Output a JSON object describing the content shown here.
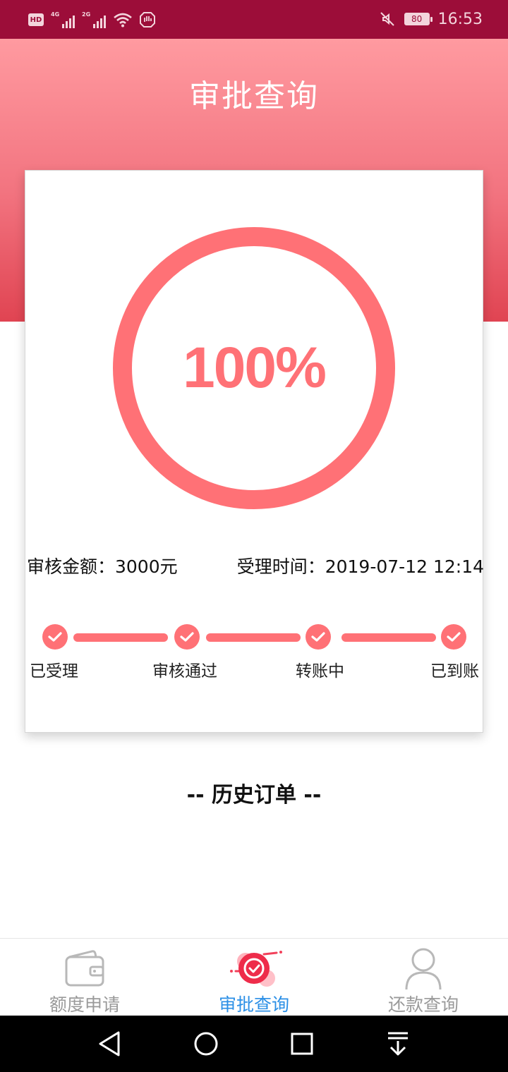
{
  "status_bar": {
    "hd": "HD",
    "signal1_label": "4G",
    "signal2_label": "2G",
    "battery": "80",
    "time": "16:53",
    "icons": [
      "hd-badge",
      "signal-4g-icon",
      "signal-2g-icon",
      "wifi-icon",
      "hand-icon",
      "mute-icon",
      "battery-icon"
    ]
  },
  "header": {
    "title": "审批查询"
  },
  "progress": {
    "percent_text": "100%",
    "value": 1.0
  },
  "info": {
    "amount": "审核金额：3000元",
    "time": "受理时间：2019-07-12 12:14"
  },
  "steps": [
    {
      "label": "已受理",
      "done": true
    },
    {
      "label": "审核通过",
      "done": true
    },
    {
      "label": "转账中",
      "done": true
    },
    {
      "label": "已到账",
      "done": true
    }
  ],
  "history": {
    "title": "-- 历史订单 --"
  },
  "tabs": [
    {
      "label": "额度申请",
      "icon": "wallet-icon",
      "active": false
    },
    {
      "label": "审批查询",
      "icon": "approval-check-icon",
      "active": true
    },
    {
      "label": "还款查询",
      "icon": "user-icon",
      "active": false
    }
  ],
  "colors": {
    "status_bar": "#9c0d39",
    "accent": "#ff7176",
    "tab_active": "#2b8fe6",
    "tab_inactive": "#9a9a9a"
  },
  "navbar": {
    "icons": [
      "back-icon",
      "home-icon",
      "recents-icon",
      "notification-pull-icon"
    ]
  }
}
